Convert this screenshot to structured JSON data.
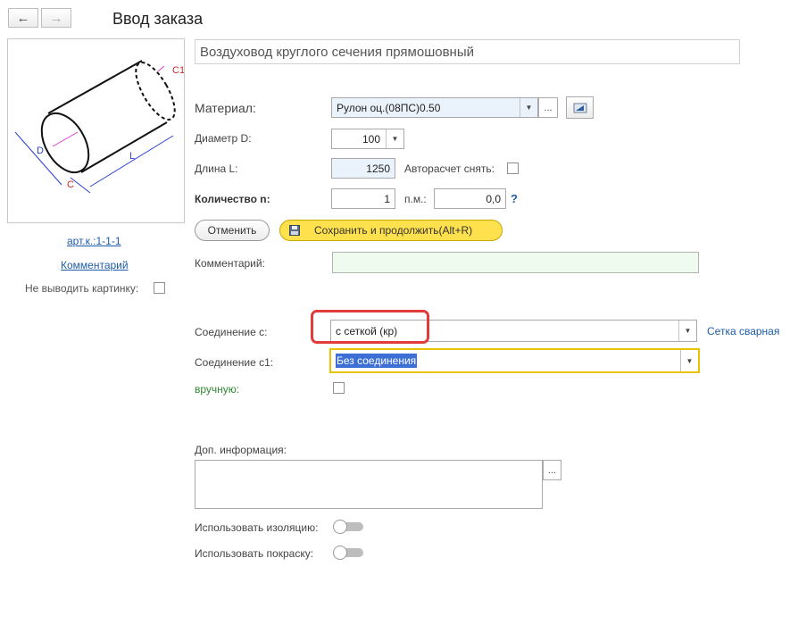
{
  "window": {
    "title": "Ввод заказа"
  },
  "nav": {
    "back_icon": "←",
    "forward_icon": "→"
  },
  "product": {
    "name": "Воздуховод круглого сечения прямошовный",
    "article_link": "арт.к.:1-1-1",
    "comment_link": "Комментарий",
    "hide_picture_label": "Не выводить картинку:",
    "picture_letters": {
      "c1": "C1",
      "c": "C",
      "d": "D",
      "l": "L"
    }
  },
  "form": {
    "material": {
      "label": "Материал:",
      "value": "Рулон оц.(08ПС)0.50",
      "more": "..."
    },
    "diameter": {
      "label": "Диаметр D:",
      "value": "100"
    },
    "length": {
      "label": "Длина L:",
      "value": "1250"
    },
    "autocalc": {
      "label": "Авторасчет снять:"
    },
    "quantity": {
      "label": "Количество n:",
      "value": "1",
      "unit": "п.м.:",
      "unit_value": "0,0",
      "help": "?"
    },
    "cancel_label": "Отменить",
    "save_label": "Сохранить и продолжить(Alt+R)",
    "comment": {
      "label": "Комментарий:",
      "value": ""
    },
    "connection_c": {
      "label": "Соединение с:",
      "value": "с сеткой (кр)",
      "link": "Сетка сварная"
    },
    "connection_c1": {
      "label": "Соединение с1:",
      "value": "Без соединения"
    },
    "manual": {
      "label": "вручную:"
    },
    "extra_info": {
      "label": "Доп. информация:",
      "value": "",
      "more": "..."
    },
    "use_insulation": {
      "label": "Использовать изоляцию:"
    },
    "use_painting": {
      "label": "Использовать покраску:"
    }
  },
  "colors": {
    "link": "#1f5ca8",
    "highlight_border": "#e23b3b",
    "focused_border": "#e8c400",
    "selection": "#3d6fd6",
    "save_button": "#ffe14d",
    "manual_label": "#2f8a2f",
    "comment_bg": "#f0fbef",
    "length_bg": "#eaf3fb"
  }
}
